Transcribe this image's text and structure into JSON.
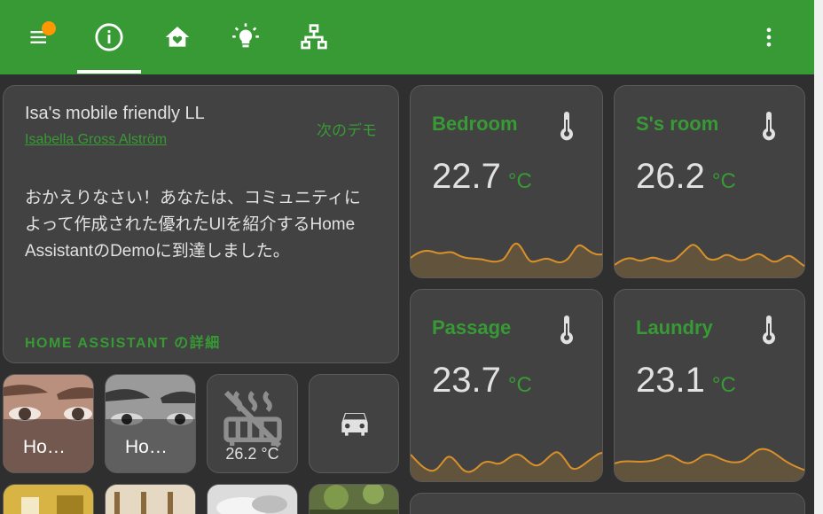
{
  "header": {
    "tabs": [
      {
        "icon": "menu-icon"
      },
      {
        "icon": "information-icon"
      },
      {
        "icon": "home-heart-icon"
      },
      {
        "icon": "lightbulb-icon"
      },
      {
        "icon": "network-icon"
      }
    ],
    "more_icon": "dots-vertical-icon",
    "badge_color": "#ff9800"
  },
  "colors": {
    "accent": "#389a35",
    "card": "#424242",
    "graph": "#d8912a"
  },
  "intro": {
    "title": "Isa's mobile friendly LL",
    "author": "Isabella Gross Alström",
    "next_demo": "次のデモ",
    "body": "おかえりなさい！あなたは、コミュニティによって作成された優れたUIを紹介するHome AssistantのDemoに到達しました。",
    "link": "HOME ASSISTANT の詳細"
  },
  "sensors": [
    {
      "name": "Bedroom",
      "value": "22.7",
      "unit": "°C",
      "icon": "thermometer-icon"
    },
    {
      "name": "S's room",
      "value": "26.2",
      "unit": "°C",
      "icon": "thermometer-icon"
    },
    {
      "name": "Passage",
      "value": "23.7",
      "unit": "°C",
      "icon": "thermometer-icon"
    },
    {
      "name": "Laundry",
      "value": "23.1",
      "unit": "°C",
      "icon": "thermometer-icon"
    }
  ],
  "tiles": [
    {
      "label": "Ho…"
    },
    {
      "label": "Ho…"
    },
    {
      "state": "26.2 °C",
      "icon": "radiator-off-icon"
    },
    {
      "icon": "car-icon"
    }
  ]
}
